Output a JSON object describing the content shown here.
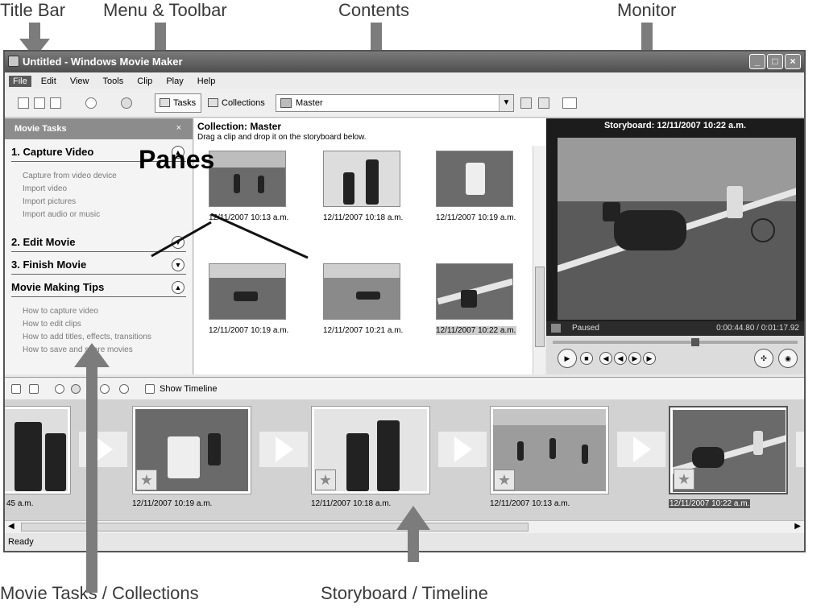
{
  "annotations": {
    "title_bar": "Title Bar",
    "menu_toolbar": "Menu & Toolbar",
    "contents": "Contents",
    "monitor": "Monitor",
    "panes": "Panes",
    "tasks_collections": "Movie Tasks / Collections",
    "storyboard_timeline": "Storyboard / Timeline"
  },
  "window": {
    "title": "Untitled - Windows Movie Maker"
  },
  "menu": [
    "File",
    "Edit",
    "View",
    "Tools",
    "Clip",
    "Play",
    "Help"
  ],
  "toolbar": {
    "tasks_label": "Tasks",
    "collections_label": "Collections",
    "collection_select": "Master"
  },
  "tasks": {
    "header": "Movie Tasks",
    "close": "×",
    "sections": [
      {
        "title": "1. Capture Video",
        "links": [
          "Capture from video device",
          "Import video",
          "Import pictures",
          "Import audio or music"
        ]
      },
      {
        "title": "2. Edit Movie",
        "links": []
      },
      {
        "title": "3. Finish Movie",
        "links": []
      },
      {
        "title": "Movie Making Tips",
        "links": [
          "How to capture video",
          "How to edit clips",
          "How to add titles, effects, transitions",
          "How to save and share movies"
        ]
      }
    ]
  },
  "contents": {
    "title": "Collection: Master",
    "subtitle": "Drag a clip and drop it on the storyboard below.",
    "clips": [
      {
        "caption": "12/11/2007 10:13 a.m."
      },
      {
        "caption": "12/11/2007 10:18 a.m."
      },
      {
        "caption": "12/11/2007 10:19 a.m."
      },
      {
        "caption": "12/11/2007 10:19 a.m."
      },
      {
        "caption": "12/11/2007 10:21 a.m."
      },
      {
        "caption": "12/11/2007 10:22 a.m."
      }
    ]
  },
  "monitor": {
    "title": "Storyboard: 12/11/2007 10:22 a.m.",
    "state": "Paused",
    "time": "0:00:44.80 / 0:01:17.92"
  },
  "storyboard": {
    "show_timeline": "Show Timeline",
    "clips": [
      {
        "caption": "45 a.m."
      },
      {
        "caption": "12/11/2007 10:19 a.m."
      },
      {
        "caption": "12/11/2007 10:18 a.m."
      },
      {
        "caption": "12/11/2007 10:13 a.m."
      },
      {
        "caption": "12/11/2007 10:22 a.m."
      }
    ]
  },
  "status": "Ready"
}
